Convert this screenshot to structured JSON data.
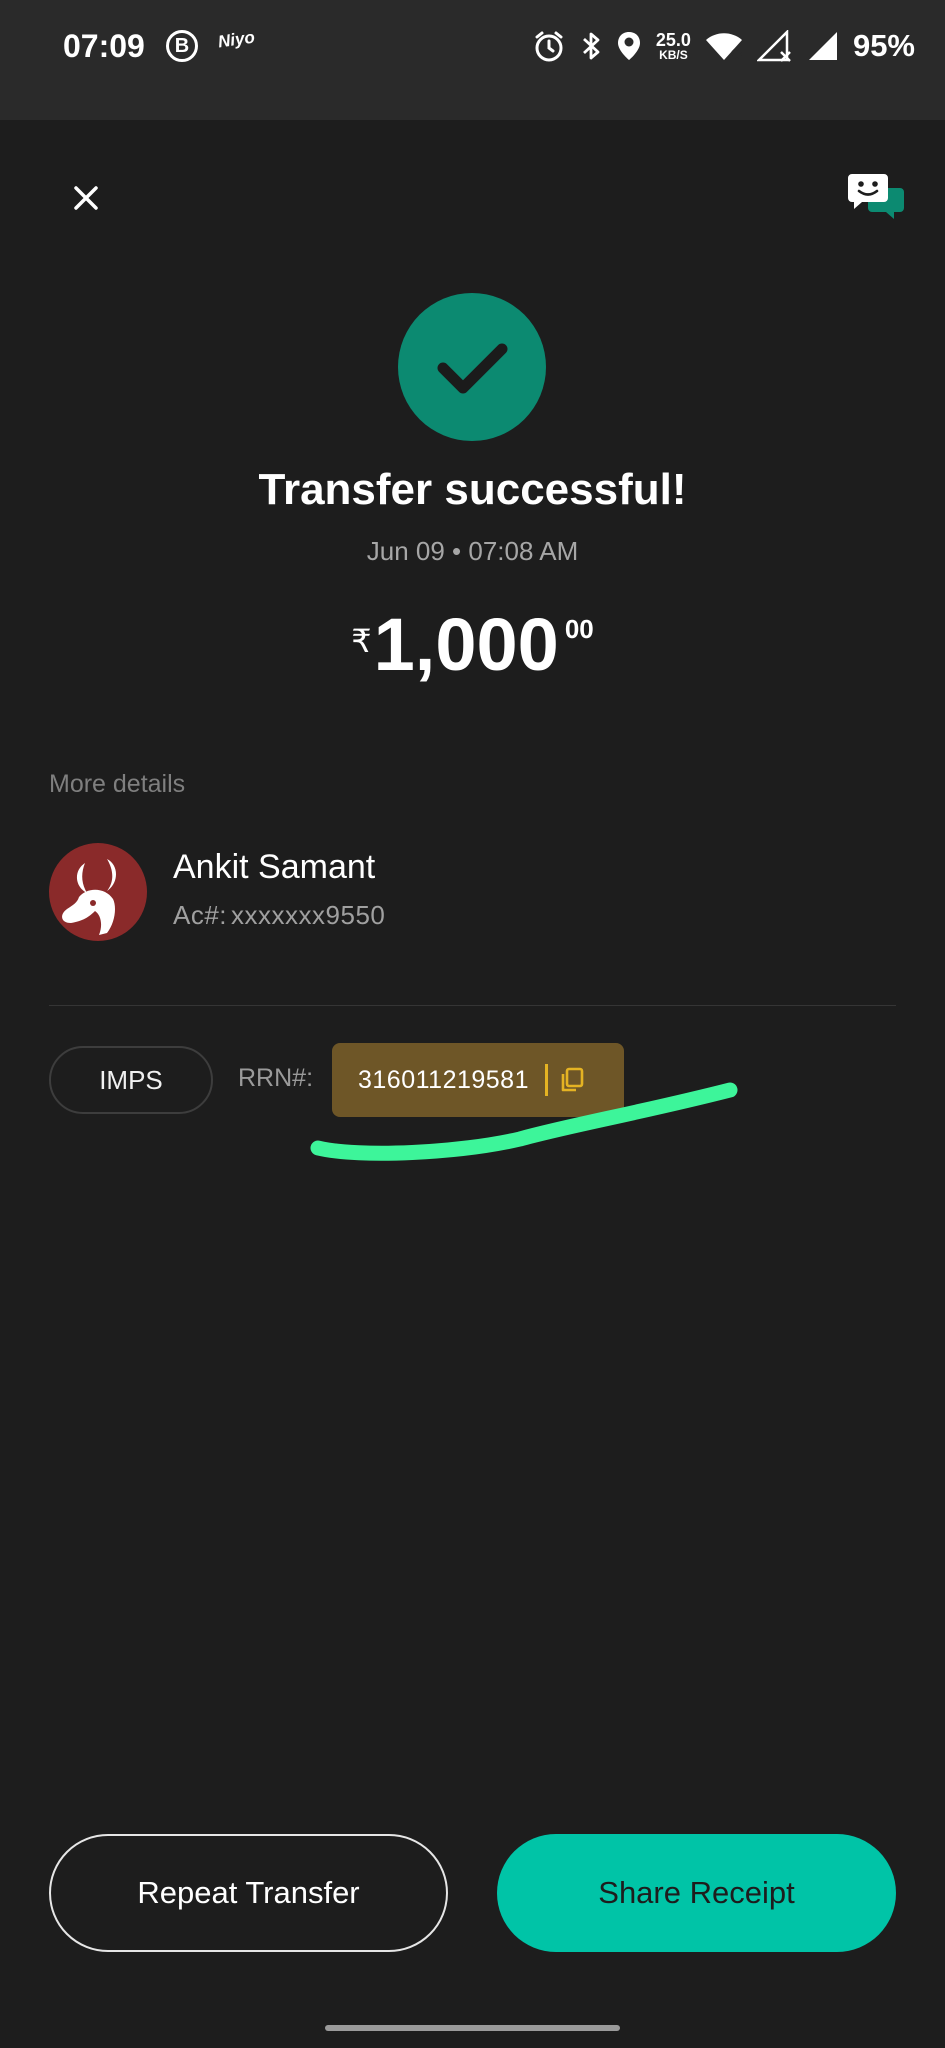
{
  "status_bar": {
    "time": "07:09",
    "b_badge": "B",
    "niyo_badge": "Niyo",
    "net_speed_value": "25.0",
    "net_speed_unit": "KB/S",
    "battery": "95%"
  },
  "receipt": {
    "title": "Transfer successful!",
    "datetime": "Jun 09 • 07:08 AM",
    "currency_symbol": "₹",
    "amount_main": "1,000",
    "amount_decimal": "00",
    "more_details_label": "More details",
    "payee_name": "Ankit Samant",
    "payee_account_label": "Ac#:",
    "payee_account": "xxxxxxx9550",
    "transfer_mode": "IMPS",
    "rrn_label": "RRN#:",
    "rrn_value": "316011219581"
  },
  "actions": {
    "repeat_label": "Repeat Transfer",
    "share_label": "Share Receipt"
  },
  "icons": {
    "close": "close-icon",
    "chat": "chat-support-icon",
    "success": "check-icon",
    "copy": "copy-icon"
  },
  "colors": {
    "background": "#1d1d1d",
    "success_green": "#0c8a71",
    "accent_teal": "#00c4a7",
    "rrn_box": "#6e5627",
    "copy_gold": "#e5b323",
    "highlight_stroke": "#3df59a"
  }
}
